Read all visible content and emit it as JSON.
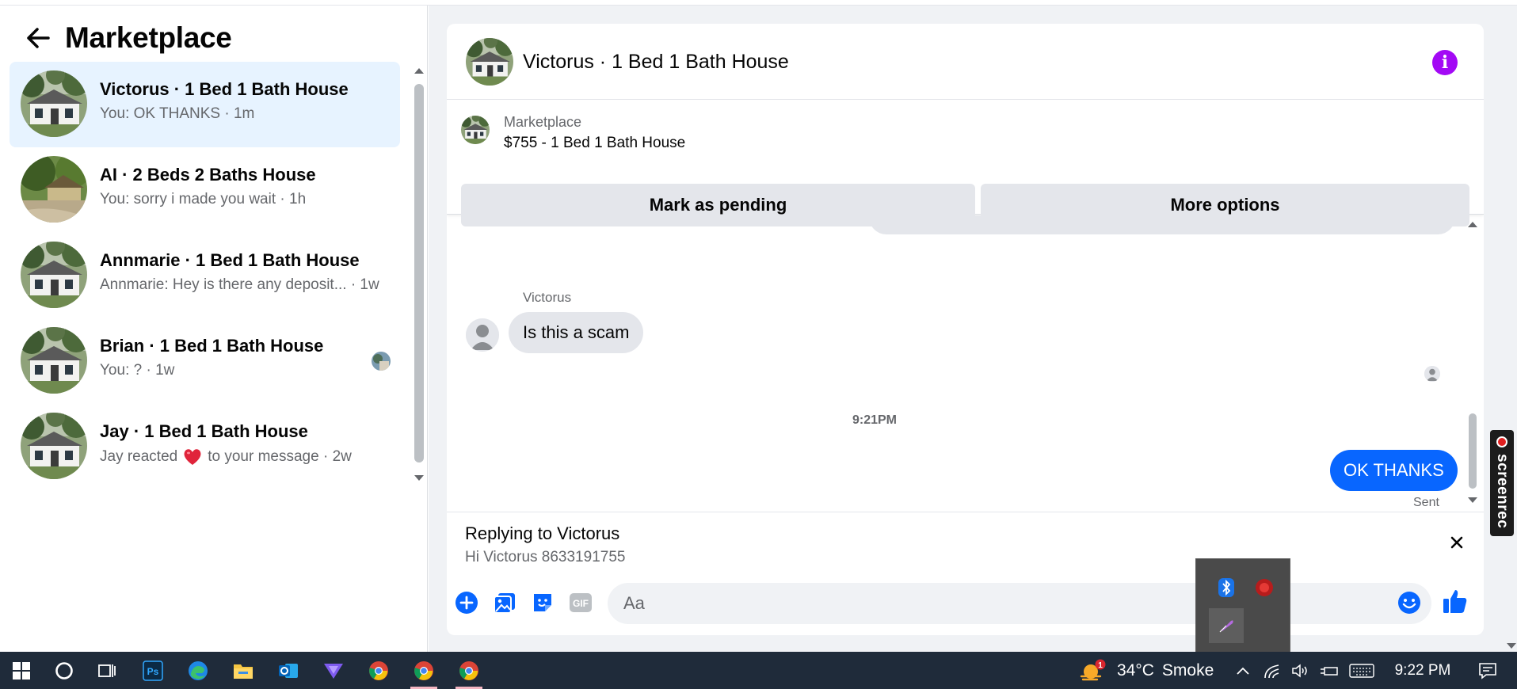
{
  "sidebar": {
    "title": "Marketplace",
    "conversations": [
      {
        "title": "Victorus · 1 Bed 1 Bath House",
        "subtitle": "You: OK THANKS · 1m"
      },
      {
        "title": "AI · 2 Beds 2 Baths House",
        "subtitle": "You: sorry i made you wait · 1h"
      },
      {
        "title": "Annmarie · 1 Bed 1 Bath House",
        "subtitle": "Annmarie: Hey is there any deposit... · 1w"
      },
      {
        "title": "Brian · 1 Bed 1 Bath House",
        "subtitle": "You: ? · 1w"
      },
      {
        "title": "Jay · 1 Bed 1 Bath House",
        "subtitle_pre": "Jay reacted",
        "subtitle_post": "to your message · 2w"
      }
    ]
  },
  "chat": {
    "title": "Victorus · 1 Bed 1 Bath House",
    "listing": {
      "label": "Marketplace",
      "price_title": "$755 - 1 Bed 1 Bath House",
      "pending_label": "Mark as pending",
      "options_label": "More options"
    },
    "messages": {
      "sender_name": "Victorus",
      "incoming": "Is this a scam",
      "timestamp": "9:21PM",
      "outgoing": "OK THANKS",
      "status": "Sent"
    },
    "reply": {
      "title": "Replying to Victorus",
      "quoted": "Hi Victorus 8633191755"
    },
    "composer": {
      "placeholder": "Aa"
    }
  },
  "overlay": {
    "screenrec_label": "screenrec"
  },
  "taskbar": {
    "weather_temp": "34°C",
    "weather_desc": "Smoke",
    "weather_badge": "1",
    "clock": "9:22 PM",
    "ps_label": "Ps"
  },
  "colors": {
    "accent_blue": "#0866ff",
    "info_purple": "#a309f5",
    "active_row": "#e7f3ff",
    "taskbar": "#1f2b3a"
  }
}
